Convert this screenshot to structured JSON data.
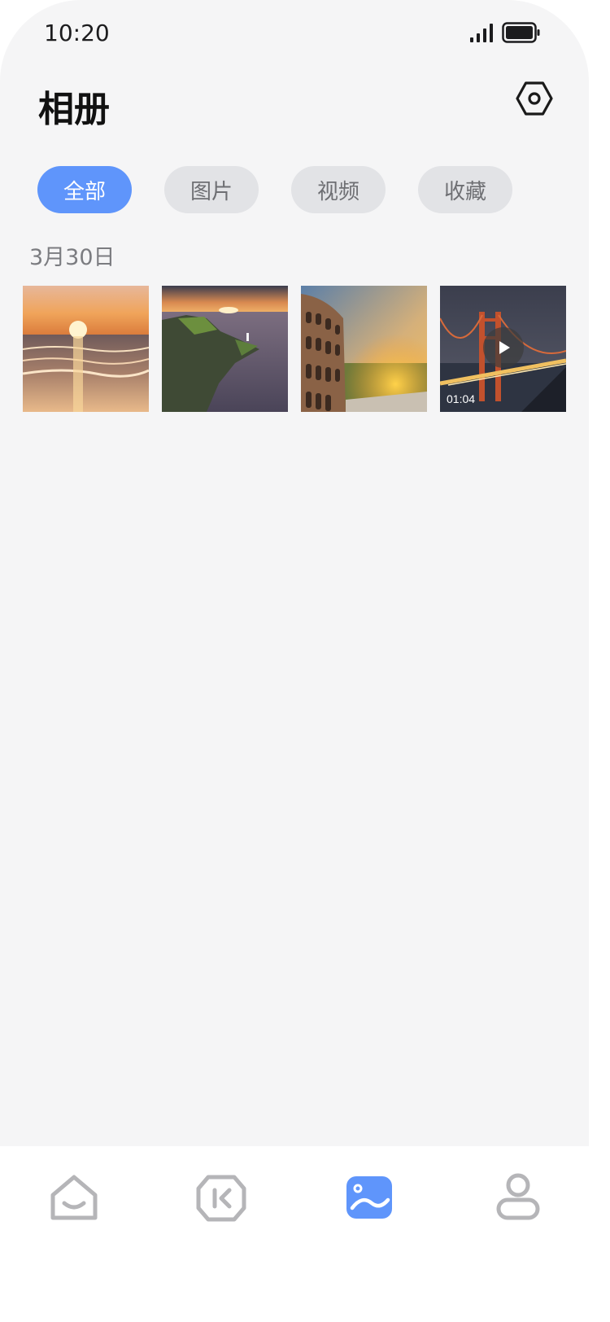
{
  "status_bar": {
    "time": "10:20"
  },
  "header": {
    "title": "相册",
    "settings_icon": "settings-hexagon-icon"
  },
  "tabs": [
    {
      "label": "全部",
      "active": true
    },
    {
      "label": "图片",
      "active": false
    },
    {
      "label": "视频",
      "active": false
    },
    {
      "label": "收藏",
      "active": false
    }
  ],
  "section": {
    "date": "3月30日"
  },
  "media": [
    {
      "kind": "photo",
      "icon": "sunset-beach-photo"
    },
    {
      "kind": "photo",
      "icon": "sea-cliff-lighthouse-photo"
    },
    {
      "kind": "photo",
      "icon": "colosseum-sunset-photo"
    },
    {
      "kind": "video",
      "icon": "golden-gate-bridge-video",
      "duration": "01:04"
    }
  ],
  "bottom_nav": [
    {
      "icon": "home-icon",
      "active": false
    },
    {
      "icon": "video-icon",
      "active": false
    },
    {
      "icon": "album-icon",
      "active": true
    },
    {
      "icon": "profile-icon",
      "active": false
    }
  ],
  "colors": {
    "accent": "#5f95fb",
    "background": "#f5f5f6",
    "inactive_icon": "#b5b5b8",
    "tab_inactive": "#e2e3e6"
  }
}
